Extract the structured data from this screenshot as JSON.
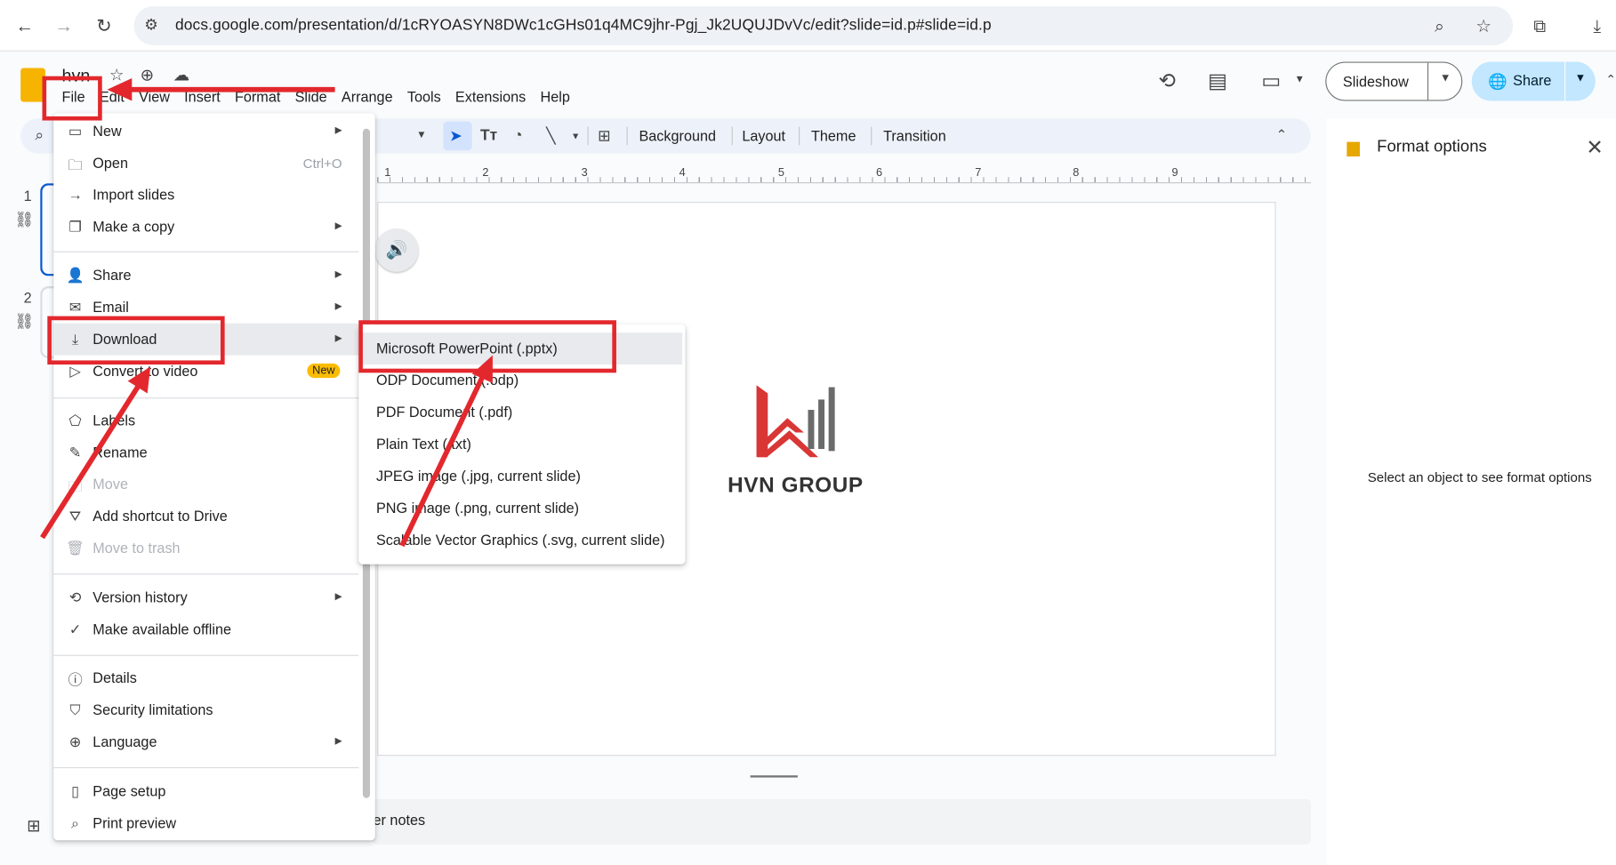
{
  "browser": {
    "url": "docs.google.com/presentation/d/1cRYOASYN8DWc1cGHs01q4MC9jhr-Pgj_Jk2UQUJDvVc/edit?slide=id.p#slide=id.p",
    "icons": [
      "back-icon",
      "forward-icon",
      "reload-icon",
      "site-settings-icon",
      "zoom-icon",
      "bookmark-star-icon",
      "extensions-icon",
      "download-icon"
    ]
  },
  "doc": {
    "title": "hvn",
    "menus": [
      "File",
      "Edit",
      "View",
      "Insert",
      "Format",
      "Slide",
      "Arrange",
      "Tools",
      "Extensions",
      "Help"
    ],
    "slideshow_label": "Slideshow",
    "share_label": "Share"
  },
  "toolbar": {
    "background": "Background",
    "layout": "Layout",
    "theme": "Theme",
    "transition": "Transition"
  },
  "ruler": [
    "1",
    "2",
    "3",
    "4",
    "5",
    "6",
    "7",
    "8",
    "9"
  ],
  "filmstrip": {
    "slide_numbers": [
      "1",
      "2"
    ]
  },
  "slide": {
    "logo_text": "HVN GROUP",
    "logo_colors": {
      "red": "#d93636",
      "gray": "#6b6b6b"
    }
  },
  "notes": {
    "placeholder": "er notes"
  },
  "format_panel": {
    "title": "Format options",
    "hint": "Select an object to see format options"
  },
  "file_menu": {
    "items": [
      {
        "label": "New",
        "icon": "new-presentation-icon",
        "submenu": true
      },
      {
        "label": "Open",
        "icon": "folder-open-icon",
        "shortcut": "Ctrl+O"
      },
      {
        "label": "Import slides",
        "icon": "import-icon"
      },
      {
        "label": "Make a copy",
        "icon": "copy-icon",
        "submenu": true
      },
      {
        "label": "Share",
        "icon": "person-add-icon",
        "submenu": true
      },
      {
        "label": "Email",
        "icon": "email-icon",
        "submenu": true
      },
      {
        "label": "Download",
        "icon": "download-icon",
        "submenu": true
      },
      {
        "label": "Convert to video",
        "icon": "video-icon",
        "badge": "New"
      },
      {
        "label": "Labels",
        "icon": "label-icon"
      },
      {
        "label": "Rename",
        "icon": "pencil-icon"
      },
      {
        "label": "Move",
        "icon": "move-folder-icon",
        "disabled": true
      },
      {
        "label": "Add shortcut to Drive",
        "icon": "drive-shortcut-icon"
      },
      {
        "label": "Move to trash",
        "icon": "trash-icon",
        "disabled": true
      },
      {
        "label": "Version history",
        "icon": "history-icon",
        "submenu": true
      },
      {
        "label": "Make available offline",
        "icon": "offline-icon"
      },
      {
        "label": "Details",
        "icon": "info-icon"
      },
      {
        "label": "Security limitations",
        "icon": "security-icon"
      },
      {
        "label": "Language",
        "icon": "globe-icon",
        "submenu": true
      },
      {
        "label": "Page setup",
        "icon": "page-setup-icon"
      },
      {
        "label": "Print preview",
        "icon": "print-preview-icon"
      }
    ]
  },
  "download_menu": {
    "items": [
      "Microsoft PowerPoint (.pptx)",
      "ODP Document (.odp)",
      "PDF Document (.pdf)",
      "Plain Text (.txt)",
      "JPEG image (.jpg, current slide)",
      "PNG image (.png, current slide)",
      "Scalable Vector Graphics (.svg, current slide)"
    ]
  },
  "colors": {
    "accent": "#0b57d0",
    "annotation_red": "#e3282d",
    "share_bg": "#c2e7ff",
    "highlight": "#e8eaed"
  }
}
